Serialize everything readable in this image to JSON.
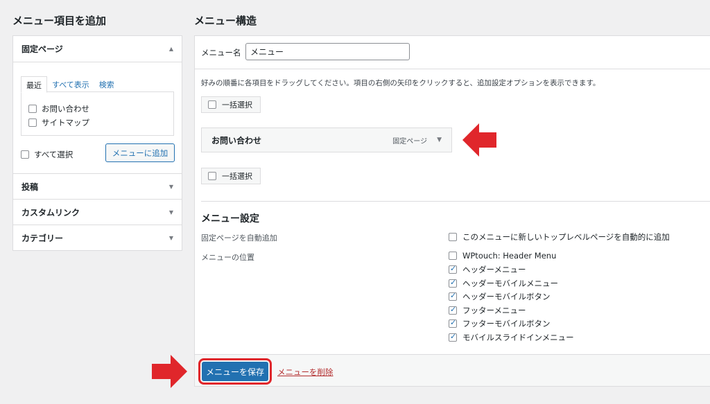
{
  "left": {
    "heading": "メニュー項目を追加",
    "fixed_pages": {
      "title": "固定ページ",
      "tabs": [
        "最近",
        "すべて表示",
        "検索"
      ],
      "items": [
        "お問い合わせ",
        "サイトマップ"
      ],
      "select_all": "すべて選択",
      "add_button": "メニューに追加"
    },
    "sections": [
      "投稿",
      "カスタムリンク",
      "カテゴリー"
    ]
  },
  "right": {
    "heading": "メニュー構造",
    "menu_name_label": "メニュー名",
    "menu_name_value": "メニュー",
    "instructions": "好みの順番に各項目をドラッグしてください。項目の右側の矢印をクリックすると、追加設定オプションを表示できます。",
    "bulk_select": "一括選択",
    "menu_item": {
      "name": "お問い合わせ",
      "type": "固定ページ"
    },
    "settings": {
      "title": "メニュー設定",
      "auto_add_label": "固定ページを自動追加",
      "auto_add_option": "このメニューに新しいトップレベルページを自動的に追加",
      "location_label": "メニューの位置",
      "locations": [
        {
          "label": "WPtouch: Header Menu",
          "checked": false
        },
        {
          "label": "ヘッダーメニュー",
          "checked": true
        },
        {
          "label": "ヘッダーモバイルメニュー",
          "checked": true
        },
        {
          "label": "ヘッダーモバイルボタン",
          "checked": true
        },
        {
          "label": "フッターメニュー",
          "checked": true
        },
        {
          "label": "フッターモバイルボタン",
          "checked": true
        },
        {
          "label": "モバイルスライドインメニュー",
          "checked": true
        }
      ]
    },
    "save_button": "メニューを保存",
    "delete_link": "メニューを削除"
  },
  "colors": {
    "accent": "#2271b1",
    "highlight": "#e0262b",
    "delete": "#b32d2e"
  }
}
